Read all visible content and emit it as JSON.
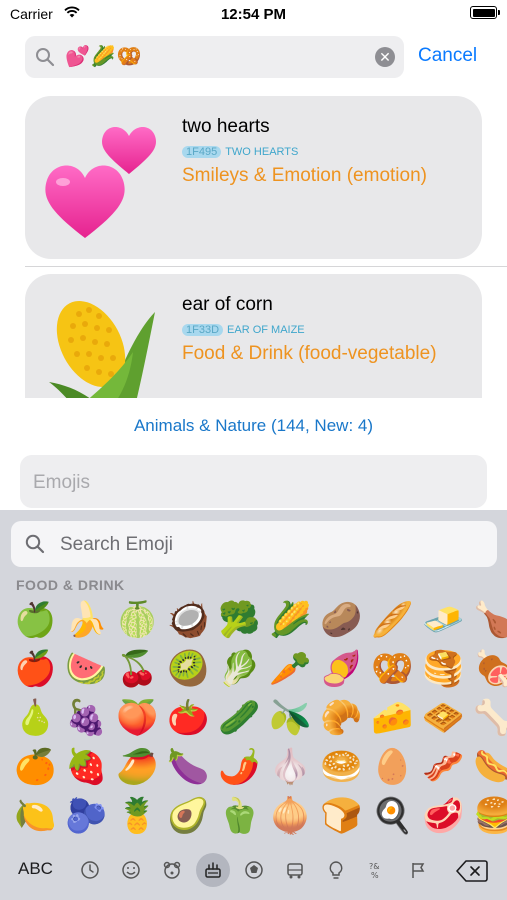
{
  "status_bar": {
    "carrier": "Carrier",
    "time": "12:54 PM"
  },
  "search": {
    "value": "💕🌽🥨",
    "cancel_label": "Cancel"
  },
  "results": [
    {
      "name": "two hearts",
      "code": "1F495",
      "unicode_name": "TWO HEARTS",
      "category": "Smileys & Emotion (emotion)",
      "emoji_icon": "two-hearts-icon"
    },
    {
      "name": "ear of corn",
      "code": "1F33D",
      "unicode_name": "EAR OF MAIZE",
      "category": "Food & Drink (food-vegetable)",
      "emoji_icon": "ear-of-corn-icon"
    }
  ],
  "section_label": "Animals & Nature (144, New: 4)",
  "emoji_field": {
    "placeholder": "Emojis"
  },
  "keyboard": {
    "search_placeholder": "Search Emoji",
    "section_title": "FOOD & DRINK",
    "emojis": [
      "🍏",
      "🍌",
      "🍈",
      "🥥",
      "🥦",
      "🌽",
      "🥔",
      "🥖",
      "🧈",
      "🍗",
      "🍎",
      "🍉",
      "🍒",
      "🥝",
      "🥬",
      "🥕",
      "🍠",
      "🥨",
      "🥞",
      "🍖",
      "🍐",
      "🍇",
      "🍑",
      "🍅",
      "🥒",
      "🫒",
      "🥐",
      "🧀",
      "🧇",
      "🦴",
      "🍊",
      "🍓",
      "🥭",
      "🍆",
      "🌶️",
      "🧄",
      "🥯",
      "🥚",
      "🥓",
      "🌭",
      "🍋",
      "🫐",
      "🍍",
      "🥑",
      "🫑",
      "🧅",
      "🍞",
      "🍳",
      "🥩",
      "🍔"
    ],
    "abc_label": "ABC",
    "categories": [
      "recent-icon",
      "smileys-icon",
      "animals-icon",
      "food-icon",
      "activity-icon",
      "travel-icon",
      "objects-icon",
      "symbols-icon",
      "flags-icon"
    ],
    "active_category": "food-icon"
  },
  "colors": {
    "accent_blue": "#0a7aff",
    "category_orange": "#ee9320",
    "code_teal": "#3fa6cc",
    "keyboard_bg": "#d4d6dc"
  }
}
